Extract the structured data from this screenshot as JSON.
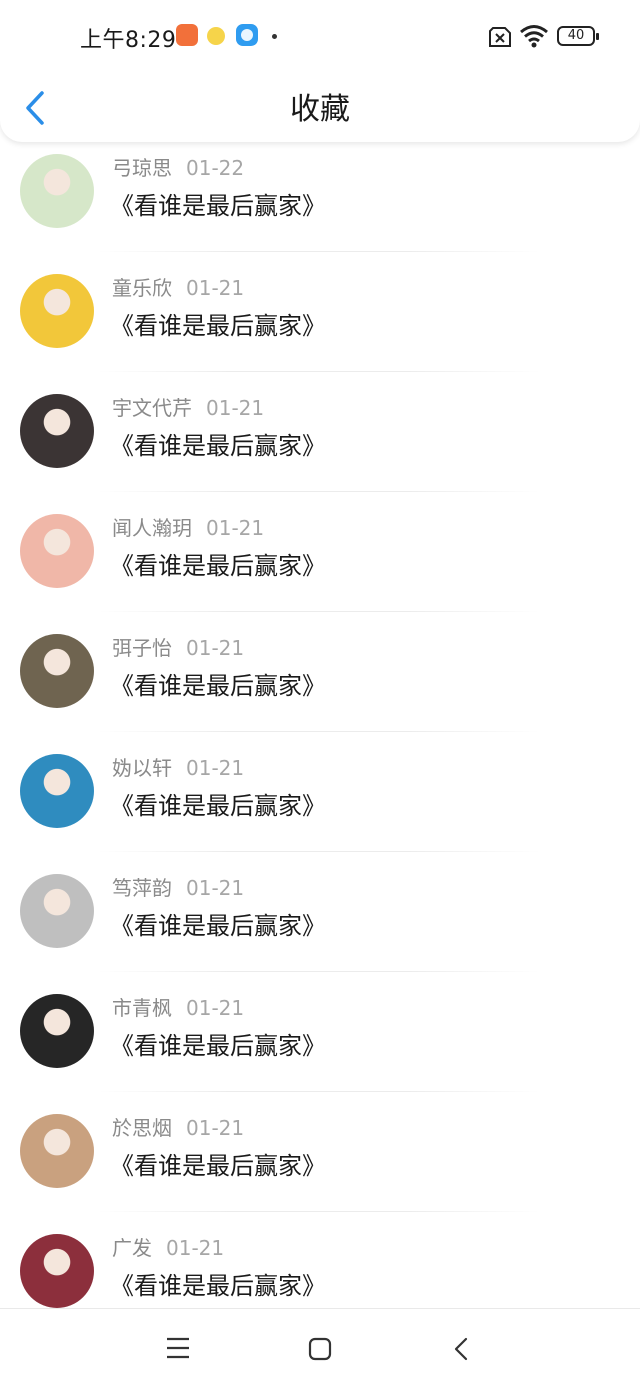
{
  "status_bar": {
    "time": "上午8:29",
    "battery": "40",
    "icons": [
      "orange-app-icon",
      "yellow-app-icon",
      "blue-app-icon",
      "dot",
      "sim-off-icon",
      "wifi-icon",
      "battery-icon"
    ]
  },
  "header": {
    "title": "收藏",
    "back_icon": "chevron-left-icon"
  },
  "items": [
    {
      "name": "弓琼思",
      "date": "01-22",
      "title": "《看谁是最后赢家》",
      "avatar_color": "#d6e7c9"
    },
    {
      "name": "童乐欣",
      "date": "01-21",
      "title": "《看谁是最后赢家》",
      "avatar_color": "#f2c73a"
    },
    {
      "name": "宇文代芹",
      "date": "01-21",
      "title": "《看谁是最后赢家》",
      "avatar_color": "#3b3434"
    },
    {
      "name": "闻人瀚玥",
      "date": "01-21",
      "title": "《看谁是最后赢家》",
      "avatar_color": "#f0b7a8"
    },
    {
      "name": "弭子怡",
      "date": "01-21",
      "title": "《看谁是最后赢家》",
      "avatar_color": "#6f6450"
    },
    {
      "name": "妫以轩",
      "date": "01-21",
      "title": "《看谁是最后赢家》",
      "avatar_color": "#2f8cbf"
    },
    {
      "name": "笃萍韵",
      "date": "01-21",
      "title": "《看谁是最后赢家》",
      "avatar_color": "#bfbfbf"
    },
    {
      "name": "市青枫",
      "date": "01-21",
      "title": "《看谁是最后赢家》",
      "avatar_color": "#262626"
    },
    {
      "name": "於思烟",
      "date": "01-21",
      "title": "《看谁是最后赢家》",
      "avatar_color": "#c9a17f"
    },
    {
      "name": "广发",
      "date": "01-21",
      "title": "《看谁是最后赢家》",
      "avatar_color": "#8c2f3c"
    }
  ],
  "nav_bar": {
    "icons": [
      "menu-icon",
      "home-square-icon",
      "back-triangle-icon"
    ]
  }
}
